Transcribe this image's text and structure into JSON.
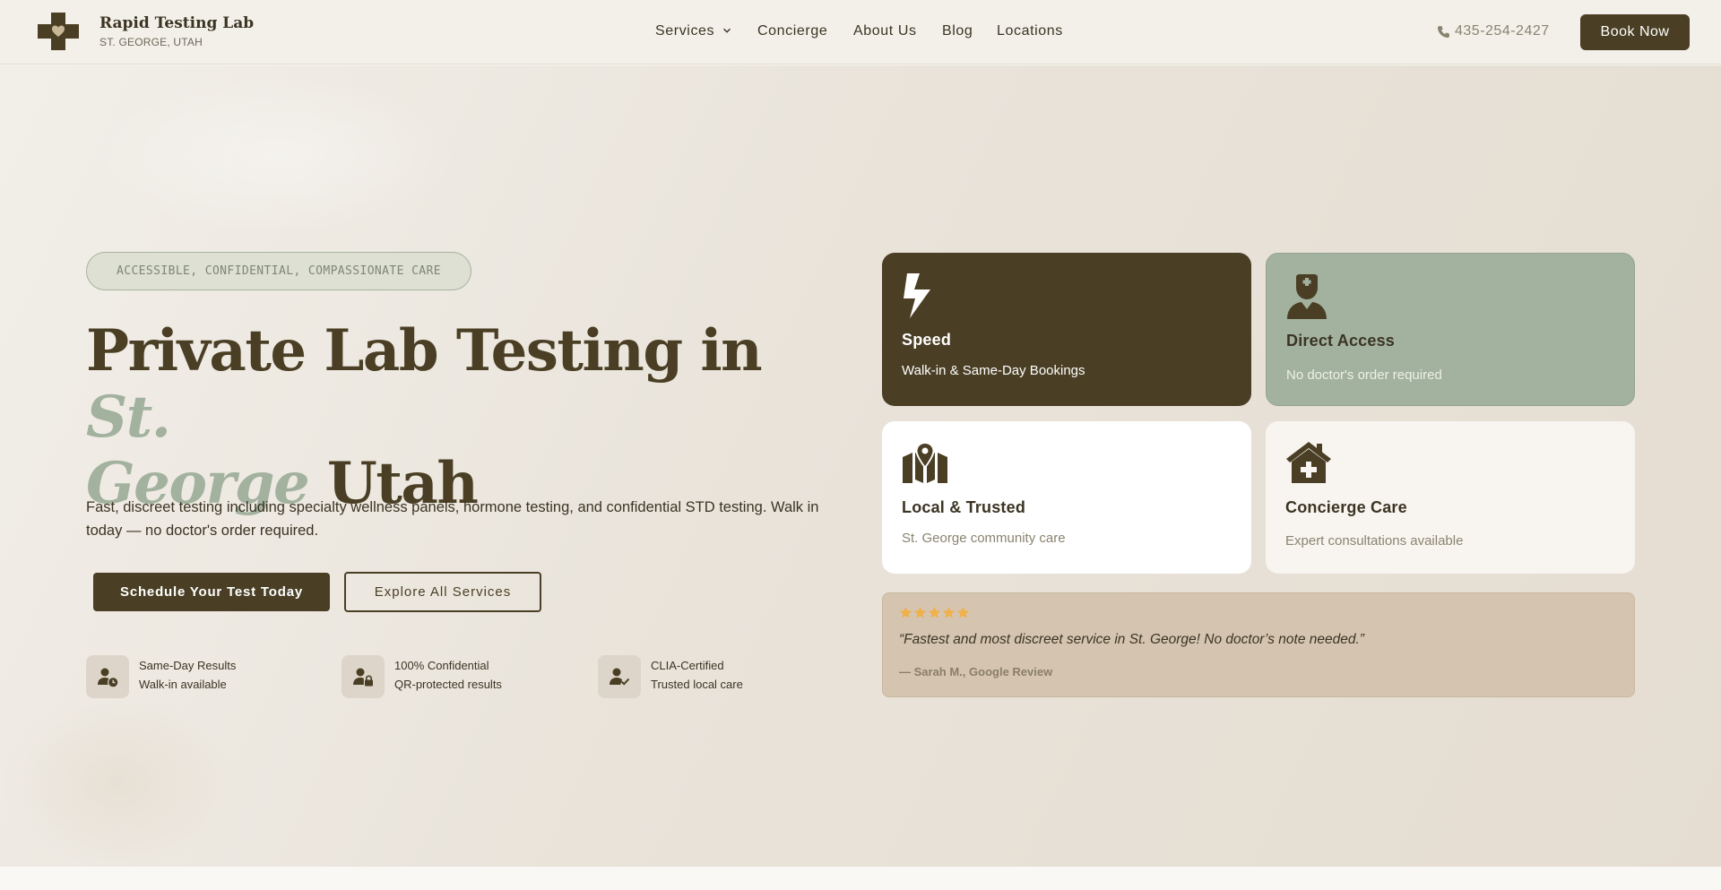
{
  "brand": {
    "name": "Rapid Testing Lab",
    "location": "ST. GEORGE, UTAH"
  },
  "nav": {
    "items": [
      "Services",
      "Concierge",
      "About Us",
      "Blog",
      "Locations"
    ]
  },
  "header": {
    "phone": "435-254-2427",
    "cta": "Book Now"
  },
  "hero": {
    "tagline": "ACCESSIBLE, CONFIDENTIAL, COMPASSIONATE CARE",
    "headline": {
      "part1": "Private Lab Testing in ",
      "accent1": "St.",
      "accent2": "George",
      "part2": " Utah"
    },
    "subtext": "Fast, discreet testing including specialty wellness panels, hormone testing, and confidential STD testing. Walk in today — no doctor's order required.",
    "primary_button": "Schedule Your Test Today",
    "secondary_button": "Explore All Services",
    "features": [
      {
        "title": "Same-Day Results",
        "subtitle": "Walk-in available",
        "icon": "user-clock-icon"
      },
      {
        "title": "100% Confidential",
        "subtitle": "QR-protected results",
        "icon": "user-lock-icon"
      },
      {
        "title": "CLIA-Certified",
        "subtitle": "Trusted local care",
        "icon": "user-check-icon"
      }
    ]
  },
  "cards": [
    {
      "title": "Speed",
      "subtitle": "Walk-in & Same-Day Bookings",
      "icon": "bolt-icon"
    },
    {
      "title": "Direct Access",
      "subtitle": "No doctor's order required",
      "icon": "doctor-icon"
    },
    {
      "title": "Local & Trusted",
      "subtitle": "St. George community care",
      "icon": "map-pin-icon"
    },
    {
      "title": "Concierge Care",
      "subtitle": "Expert consultations available",
      "icon": "house-medical-icon"
    }
  ],
  "review": {
    "rating": 5,
    "quote": "“Fastest and most discreet service in St. George! No doctor’s note needed.”",
    "attribution": "— Sarah M., Google Review"
  },
  "colors": {
    "primary": "#4a3f24",
    "sage": "#a3b29f",
    "sand": "#d5c5b0",
    "star": "#f0b04a",
    "background": "#f2efe9"
  }
}
